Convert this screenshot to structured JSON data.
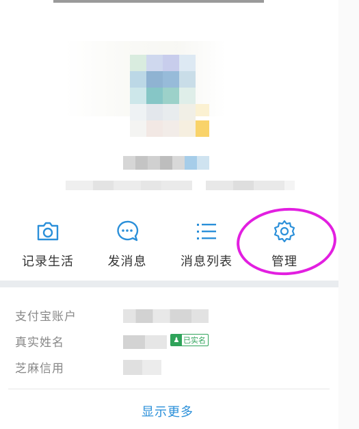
{
  "actions": [
    {
      "label": "记录生活",
      "icon": "camera-icon"
    },
    {
      "label": "发消息",
      "icon": "chat-bubble-icon"
    },
    {
      "label": "消息列表",
      "icon": "list-icon"
    },
    {
      "label": "管理",
      "icon": "gear-icon"
    }
  ],
  "info": {
    "alipay_label": "支付宝账户",
    "realname_label": "真实姓名",
    "realname_badge": "已实名",
    "sesame_label": "芝麻信用"
  },
  "show_more": "显示更多",
  "colors": {
    "accent_blue": "#2a8fd9",
    "highlight_magenta": "#e21fe0",
    "verified_green": "#2fa35a"
  }
}
